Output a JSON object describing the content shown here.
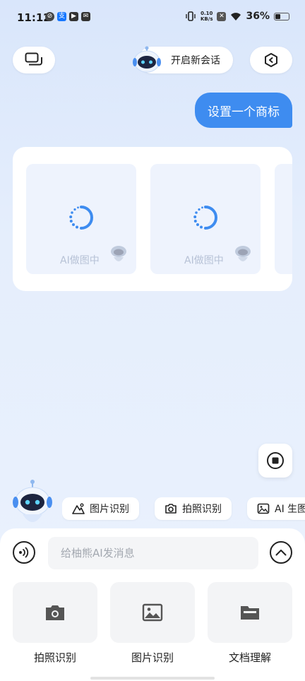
{
  "status_bar": {
    "time": "11:12",
    "net_speed_value": "0.10",
    "net_speed_unit": "KB/s",
    "battery": "36%",
    "battery_level": 0.36
  },
  "header": {
    "new_chat_label": "开启新会话",
    "chat_list_icon": "chat-bubbles-icon",
    "settings_icon": "hexagon-settings-icon"
  },
  "conversation": {
    "user_message": "设置一个商标",
    "generation_tiles": [
      {
        "label": "AI做图中"
      },
      {
        "label": "AI做图中"
      }
    ]
  },
  "quick_actions": [
    {
      "label": "图片识别",
      "icon": "image-mountain-icon"
    },
    {
      "label": "拍照识别",
      "icon": "camera-icon"
    },
    {
      "label": "AI 生图",
      "icon": "image-frame-icon"
    }
  ],
  "composer": {
    "placeholder": "给柚熊AI发消息"
  },
  "features": [
    {
      "label": "拍照识别",
      "icon": "camera-icon"
    },
    {
      "label": "图片识别",
      "icon": "picture-icon"
    },
    {
      "label": "文档理解",
      "icon": "folder-icon"
    }
  ],
  "colors": {
    "accent": "#3e8cf0",
    "background": "#e5eefc",
    "tile_bg": "#eef3fd"
  }
}
